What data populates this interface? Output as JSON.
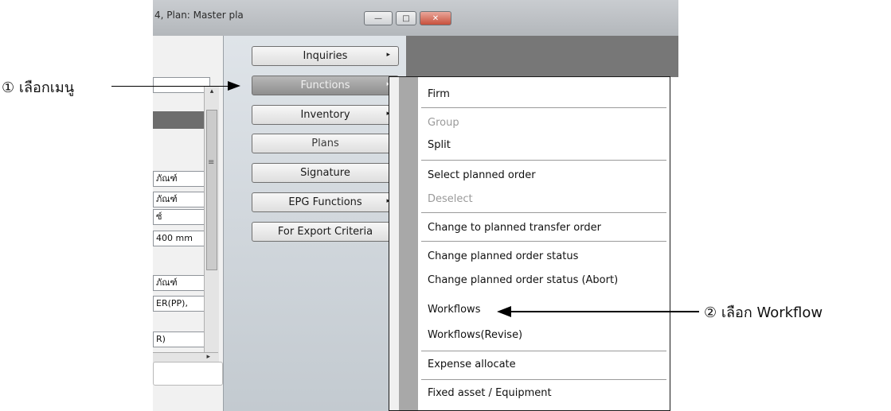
{
  "window": {
    "title": "4, Plan: Master pla",
    "min_label": "—",
    "max_label": "□",
    "close_label": "✕"
  },
  "left_panel": {
    "fields": [
      "ภัณฑ์",
      "ภัณฑ์",
      "ซ์",
      "400 mm",
      "ภัณฑ์",
      "ER(PP),",
      "R)"
    ]
  },
  "function_buttons": [
    {
      "label": "Inquiries",
      "has_submenu": true
    },
    {
      "label": "Functions",
      "has_submenu": true
    },
    {
      "label": "Inventory",
      "has_submenu": true
    },
    {
      "label": "Plans",
      "has_submenu": false
    },
    {
      "label": "Signature",
      "has_submenu": false
    },
    {
      "label": "EPG Functions",
      "has_submenu": true
    },
    {
      "label": "For Export Criteria",
      "has_submenu": false
    }
  ],
  "submenu": {
    "items": [
      {
        "label": "Firm",
        "disabled": false
      },
      {
        "label": "Group",
        "disabled": true
      },
      {
        "label": "Split",
        "disabled": false
      },
      {
        "label": "Select planned order",
        "disabled": false
      },
      {
        "label": "Deselect",
        "disabled": true
      },
      {
        "label": "Change to planned transfer order",
        "disabled": false
      },
      {
        "label": "Change planned order status",
        "disabled": false
      },
      {
        "label": "Change planned order status (Abort)",
        "disabled": false
      },
      {
        "label": "Workflows",
        "disabled": false
      },
      {
        "label": "Workflows(Revise)",
        "disabled": false
      },
      {
        "label": "Expense allocate",
        "disabled": false
      },
      {
        "label": "Fixed asset / Equipment",
        "disabled": false
      }
    ]
  },
  "annotations": {
    "step1": "① เลือกเมนู",
    "step2": "② เลือก Workflow"
  },
  "icons": {
    "submenu_arrow": "▸",
    "scroll_up": "▴",
    "scroll_down": "▾",
    "grip": "≡"
  }
}
